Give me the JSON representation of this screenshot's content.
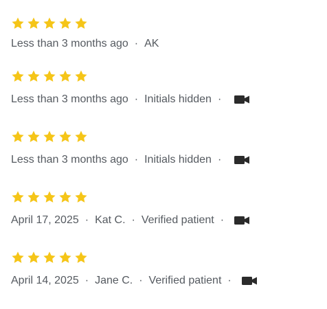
{
  "colors": {
    "star": "#F5C518",
    "meta_text": "#555A60",
    "video_icon": "#2B2B2B"
  },
  "reviews": [
    {
      "rating": 5,
      "date": "Less than 3 months ago",
      "author": "AK",
      "badge": "",
      "has_video": false
    },
    {
      "rating": 5,
      "date": "Less than 3 months ago",
      "author": "Initials hidden",
      "badge": "",
      "has_video": true
    },
    {
      "rating": 5,
      "date": "Less than 3 months ago",
      "author": "Initials hidden",
      "badge": "",
      "has_video": true
    },
    {
      "rating": 5,
      "date": "April 17, 2025",
      "author": "Kat C.",
      "badge": "Verified patient",
      "has_video": true
    },
    {
      "rating": 5,
      "date": "April 14, 2025",
      "author": "Jane C.",
      "badge": "Verified patient",
      "has_video": true
    }
  ],
  "separator": "·",
  "icons": {
    "star": "star-icon",
    "video": "video-camera-icon"
  }
}
